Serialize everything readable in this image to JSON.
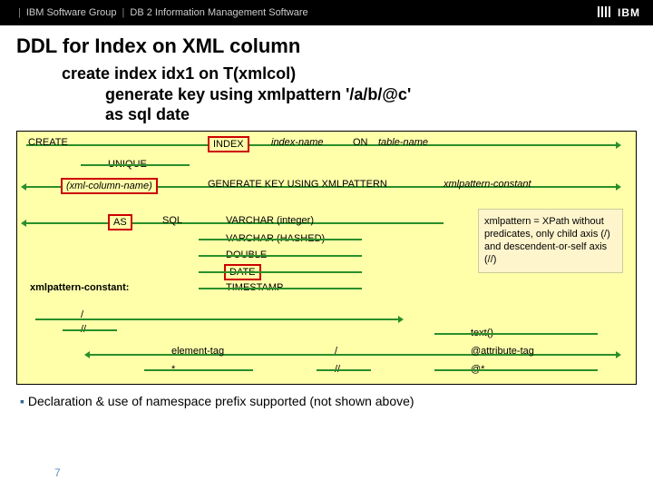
{
  "header": {
    "group": "IBM Software Group",
    "sep": "|",
    "product": "DB 2 Information Management Software",
    "logo": "IBM"
  },
  "title": "DDL for Index on XML column",
  "code": {
    "l1": "create index idx1 on T(xmlcol)",
    "l2": "generate key using xmlpattern '/a/b/@c'",
    "l3": "as sql date"
  },
  "syntax": {
    "create": "CREATE",
    "index": "INDEX",
    "indexname": "index-name",
    "on": "ON",
    "tablename": "table-name",
    "unique": "UNIQUE",
    "xmlcol": "(xml-column-name)",
    "genkey": "GENERATE KEY USING XMLPATTERN",
    "xmlpattern": "xmlpattern-constant",
    "as": "AS",
    "sql": "SQL",
    "types": {
      "varchar_int": "VARCHAR (integer)",
      "varchar_hashed": "VARCHAR (HASHED)",
      "double": "DOUBLE",
      "date": "DATE",
      "timestamp": "TIMESTAMP"
    },
    "constant_label": "xmlpattern-constant:",
    "slash": "/",
    "dslash": "//",
    "element": "element-tag",
    "star": "*",
    "text": "text()",
    "attr": "@attribute-tag",
    "atstar": "@*"
  },
  "note": "xmlpattern = XPath without predicates, only child axis (/) and descendent-or-self axis (//)",
  "bullet": "Declaration & use of namespace prefix supported (not shown above)",
  "page": "7"
}
